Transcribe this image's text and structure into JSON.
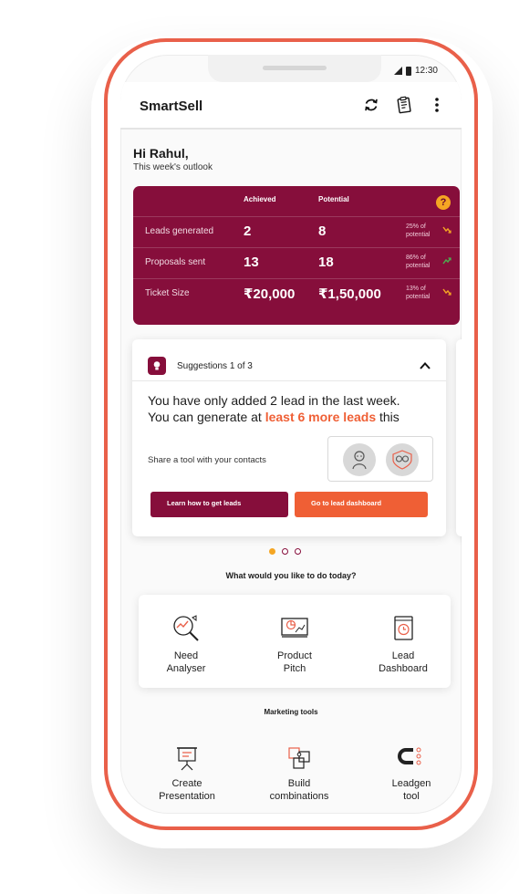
{
  "status": {
    "time": "12:30"
  },
  "app": {
    "title": "SmartSell"
  },
  "greeting": {
    "title": "Hi Rahul,",
    "subtitle": "This week's outlook"
  },
  "stats": {
    "header_achieved": "Achieved",
    "header_potential": "Potential",
    "help": "?",
    "rows": [
      {
        "label": "Leads generated",
        "achieved": "2",
        "potential": "8",
        "pct": "25% of potential",
        "trend": "down"
      },
      {
        "label": "Proposals sent",
        "achieved": "13",
        "potential": "18",
        "pct": "86% of potential",
        "trend": "up"
      },
      {
        "label": "Ticket Size",
        "achieved": "₹20,000",
        "potential": "₹1,50,000",
        "pct": "13% of potential",
        "trend": "down"
      }
    ]
  },
  "suggestion": {
    "count": "Suggestions 1 of 3",
    "line1": "You have only added 2 lead in the last week.",
    "line2_pre": "You can generate at ",
    "line2_highlight": "least 6 more leads",
    "line2_post": " this",
    "share": "Share a tool with your contacts",
    "btn_learn": "Learn how to get leads",
    "btn_dashboard": "Go to lead dashboard"
  },
  "carousel": {
    "active": 0,
    "total": 3
  },
  "todo": {
    "title": "What would you like to do today?",
    "items": [
      {
        "line1": "Need",
        "line2": "Analyser",
        "icon": "magnifier-chart-icon"
      },
      {
        "line1": "Product",
        "line2": "Pitch",
        "icon": "presentation-board-icon"
      },
      {
        "line1": "Lead",
        "line2": "Dashboard",
        "icon": "clock-book-icon"
      }
    ]
  },
  "marketing": {
    "title": "Marketing tools",
    "items": [
      {
        "line1": "Create",
        "line2": "Presentation",
        "icon": "easel-icon"
      },
      {
        "line1": "Build",
        "line2": "combinations",
        "icon": "puzzle-icon"
      },
      {
        "line1": "Leadgen",
        "line2": "tool",
        "icon": "magnet-icon"
      }
    ]
  },
  "colors": {
    "brand": "#860e3b",
    "accent": "#ef5f35",
    "frame": "#e9604a",
    "help": "#f5a623",
    "trend_up": "#4caf50"
  }
}
